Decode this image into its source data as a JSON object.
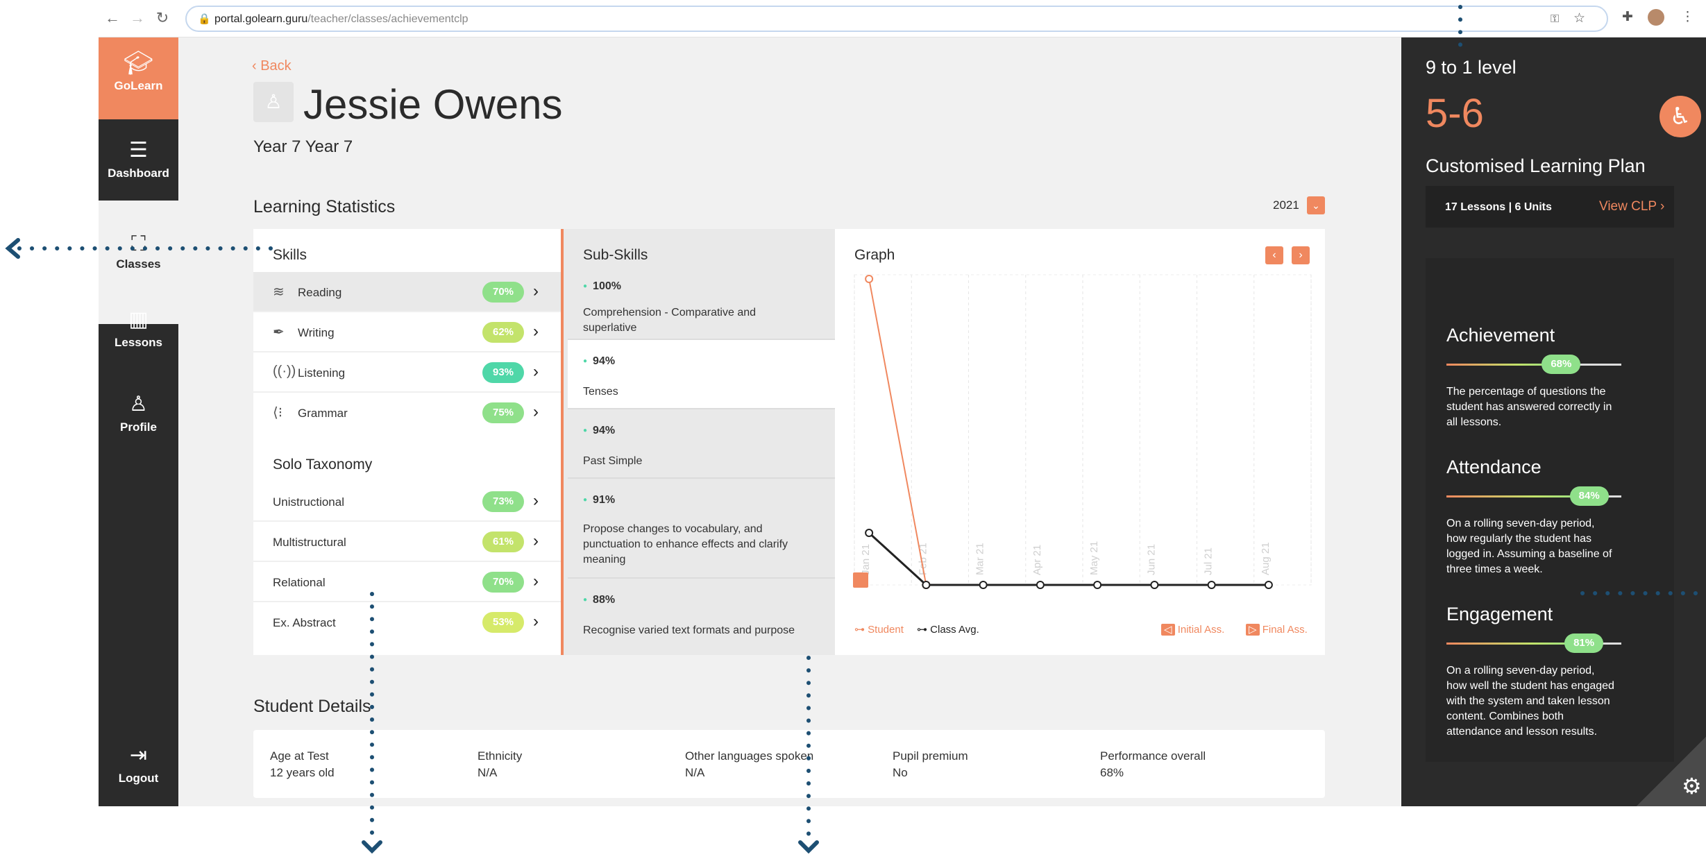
{
  "browser": {
    "url_host": "portal.golearn.guru",
    "url_path": "/teacher/classes/achievementclp"
  },
  "sidebar": {
    "brand": "GoLearn",
    "items": [
      {
        "label": "Dashboard",
        "icon": "dashboard-icon"
      },
      {
        "label": "Classes",
        "icon": "classes-icon"
      },
      {
        "label": "Lessons",
        "icon": "lessons-icon"
      },
      {
        "label": "Profile",
        "icon": "profile-icon"
      }
    ],
    "logout": "Logout"
  },
  "student": {
    "back": "Back",
    "name": "Jessie Owens",
    "year": "Year 7 Year 7"
  },
  "stats": {
    "title": "Learning Statistics",
    "year": "2021"
  },
  "skills": {
    "title": "Skills",
    "items": [
      {
        "label": "Reading",
        "pct": "70%",
        "color": "#8fe08a",
        "icon": "reading-icon"
      },
      {
        "label": "Writing",
        "pct": "62%",
        "color": "#c3e36b",
        "icon": "writing-icon"
      },
      {
        "label": "Listening",
        "pct": "93%",
        "color": "#4fd7a8",
        "icon": "listening-icon"
      },
      {
        "label": "Grammar",
        "pct": "75%",
        "color": "#8fe08a",
        "icon": "grammar-icon"
      }
    ],
    "solo_title": "Solo Taxonomy",
    "solo": [
      {
        "label": "Unistructional",
        "pct": "73%",
        "color": "#8fe08a"
      },
      {
        "label": "Multistructural",
        "pct": "61%",
        "color": "#c3e36b"
      },
      {
        "label": "Relational",
        "pct": "70%",
        "color": "#8fe08a"
      },
      {
        "label": "Ex. Abstract",
        "pct": "53%",
        "color": "#d6ea6a"
      }
    ]
  },
  "subskills": {
    "title": "Sub-Skills",
    "items": [
      {
        "pct": "100%",
        "text": "Comprehension - Comparative and superlative"
      },
      {
        "pct": "94%",
        "text": "Tenses"
      },
      {
        "pct": "94%",
        "text": "Past Simple"
      },
      {
        "pct": "91%",
        "text": "Propose changes to vocabulary, and punctuation to enhance effects and clarify meaning"
      },
      {
        "pct": "88%",
        "text": "Recognise varied text formats and purpose"
      }
    ]
  },
  "graph": {
    "title": "Graph",
    "legend_student": "Student",
    "legend_class": "Class Avg.",
    "legend_initial": "Initial Ass.",
    "legend_final": "Final Ass."
  },
  "chart_data": {
    "type": "line",
    "categories": [
      "Jan 21",
      "Feb 21",
      "Mar 21",
      "Apr 21",
      "May 21",
      "Jun 21",
      "Jul 21",
      "Aug 21"
    ],
    "ylim": [
      0,
      100
    ],
    "series": [
      {
        "name": "Student",
        "values": [
          100,
          0,
          null,
          null,
          null,
          null,
          null,
          null
        ],
        "color": "#f0885f"
      },
      {
        "name": "Class Avg.",
        "values": [
          17,
          0,
          0,
          0,
          0,
          0,
          0,
          0
        ],
        "color": "#222222"
      }
    ]
  },
  "details": {
    "title": "Student Details",
    "fields": [
      {
        "label": "Age at Test",
        "value": "12 years old"
      },
      {
        "label": "Ethnicity",
        "value": "N/A"
      },
      {
        "label": "Other languages spoken",
        "value": "N/A"
      },
      {
        "label": "Pupil premium",
        "value": "No"
      },
      {
        "label": "Performance overall",
        "value": "68%"
      }
    ]
  },
  "right": {
    "level_label": "9 to 1 level",
    "level_value": "5-6",
    "clp_title": "Customised Learning Plan",
    "clp_count": "17 Lessons | 6 Units",
    "clp_link": "View CLP",
    "metrics": [
      {
        "title": "Achievement",
        "pct": "68%",
        "value": 0.68,
        "desc": "The percentage of questions the student has answered correctly in all lessons."
      },
      {
        "title": "Attendance",
        "pct": "84%",
        "value": 0.84,
        "desc": "On a rolling seven-day period, how regularly the student has logged in. Assuming a baseline of three times a week."
      },
      {
        "title": "Engagement",
        "pct": "81%",
        "value": 0.81,
        "desc": "On a rolling seven-day period, how well the student has engaged with the system and taken lesson content. Combines both attendance and lesson results."
      }
    ]
  },
  "colors": {
    "accent": "#f0885f",
    "dark": "#2b2b2b",
    "annotation": "#1d4f73"
  }
}
